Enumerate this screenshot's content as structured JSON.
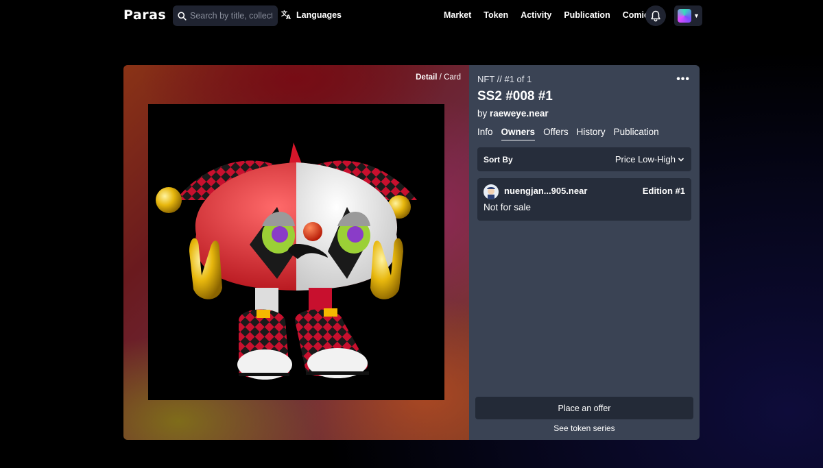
{
  "nav": {
    "logo": "Paras",
    "search_placeholder": "Search by title, collection or artist",
    "languages_label": "Languages",
    "menu": [
      "Market",
      "Token",
      "Activity",
      "Publication",
      "Comics"
    ]
  },
  "detail": {
    "view_toggle": {
      "active": "Detail",
      "separator": "/",
      "other": "Card"
    },
    "nft_line": "NFT // #1 of 1",
    "title": "SS2 #008 #1",
    "by_prefix": "by",
    "creator": "raeweye.near",
    "tabs": [
      "Info",
      "Owners",
      "Offers",
      "History",
      "Publication"
    ],
    "active_tab": "Owners",
    "sort_label": "Sort By",
    "sort_value": "Price Low-High",
    "owners": [
      {
        "name": "nuengjan...905.near",
        "edition": "Edition #1",
        "status": "Not for sale"
      }
    ],
    "offer_button": "Place an offer",
    "series_link": "See token series"
  },
  "colors": {
    "panel": "#3a4354",
    "panel_dark": "#262d3b",
    "nav_bg": "#000000"
  }
}
